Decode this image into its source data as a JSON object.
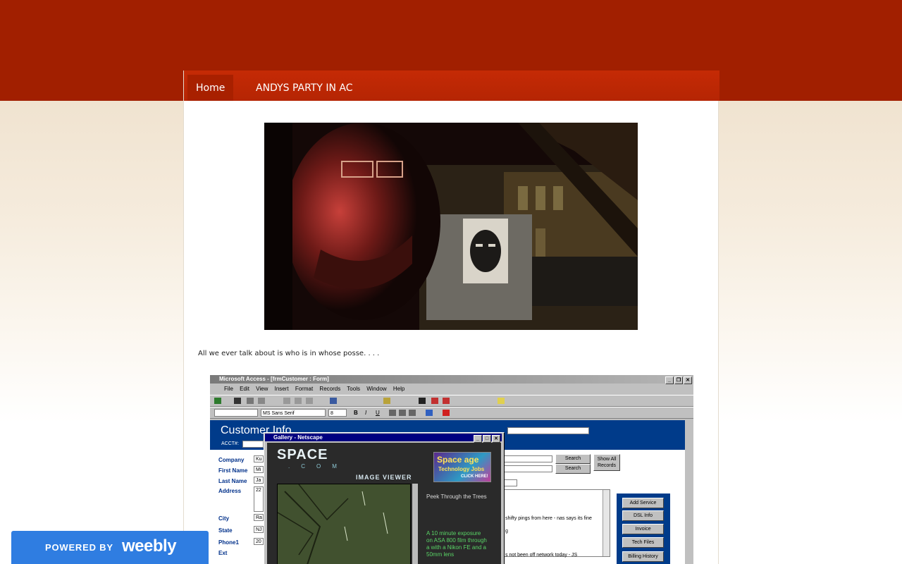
{
  "nav": {
    "items": [
      {
        "label": "Home",
        "active": true
      },
      {
        "label": "ANDYS PARTY IN AC",
        "active": false
      }
    ]
  },
  "caption": "All we ever talk about is who is in whose posse. . . .",
  "access_window": {
    "title": "Microsoft Access - [frmCustomer : Form]",
    "menu": [
      "File",
      "Edit",
      "View",
      "Insert",
      "Format",
      "Records",
      "Tools",
      "Window",
      "Help"
    ],
    "font_name": "MS Sans Serif",
    "font_size": "8",
    "form_title": "Customer Info",
    "acct_label": "ACCT#:",
    "fields": [
      {
        "label": "Company",
        "value": "Ku"
      },
      {
        "label": "First Name",
        "value": "Mi"
      },
      {
        "label": "Last Name",
        "value": "Ja"
      },
      {
        "label": "Address",
        "value": "22"
      },
      {
        "label": "City",
        "value": "Ra"
      },
      {
        "label": "State",
        "value": "NJ"
      },
      {
        "label": "Phone1",
        "value": "20"
      },
      {
        "label": "Ext",
        "value": ""
      }
    ],
    "search_button_1": "Search",
    "search_button_2": "Search",
    "show_all_records": "Show All Records",
    "notes": [
      "shifty pings from here - nas says its fine",
      "g",
      "s not been off network today - JS"
    ],
    "side_buttons": [
      "Add Service",
      "DSL Info",
      "Invoice",
      "Tech Files",
      "Billing History"
    ]
  },
  "netscape_window": {
    "title": "Gallery - Netscape",
    "logo_main": "SPACE",
    "logo_sub": ".COM",
    "viewer_label": "IMAGE VIEWER",
    "ad_line1": "Space age",
    "ad_line2": "Technology Jobs",
    "ad_line3": "CLICK HERE!",
    "photo_title": "Peek Through the Trees",
    "photo_desc": "A 10 minute exposure on ASA 800 film through a with a Nikon FE and a 50mm lens"
  },
  "badge": {
    "powered_by": "POWERED BY",
    "brand": "weebly",
    "brand_color": "#2f7de1"
  },
  "colors": {
    "header_red": "#a11f00",
    "nav_red": "#c52a05",
    "access_form_blue": "#003b8a"
  }
}
